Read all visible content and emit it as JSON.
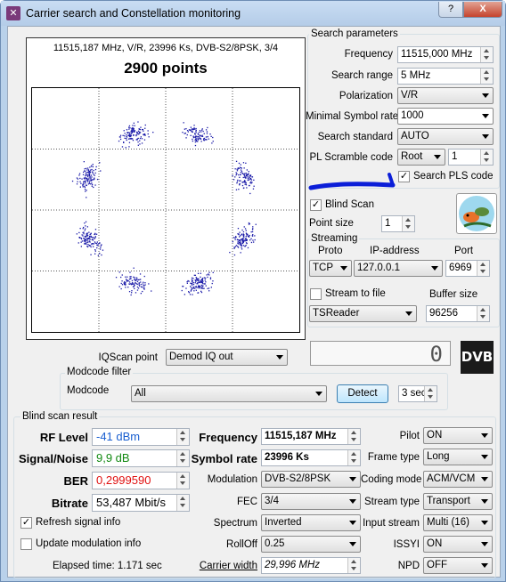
{
  "window": {
    "title": "Carrier search and Constellation monitoring",
    "help": "?",
    "close": "X"
  },
  "plot": {
    "info": "11515,187 MHz, V/R, 23996 Ks, DVB-S2/8PSK, 3/4",
    "points_label": "2900 points"
  },
  "search": {
    "group": "Search parameters",
    "frequency_label": "Frequency",
    "frequency": "11515,000 MHz",
    "range_label": "Search range",
    "range": "5 MHz",
    "polarization_label": "Polarization",
    "polarization": "V/R",
    "minsr_label": "Minimal Symbol rate",
    "minsr": "1000",
    "standard_label": "Search standard",
    "standard": "AUTO",
    "plscramble_label": "PL Scramble code",
    "plscramble_mode": "Root",
    "plscramble_value": "1",
    "search_pls_label": "Search PLS code"
  },
  "blind": {
    "label": "Blind Scan",
    "pointsize_label": "Point size",
    "pointsize": "1"
  },
  "streaming": {
    "group": "Streaming",
    "proto_label": "Proto",
    "ip_label": "IP-address",
    "port_label": "Port",
    "proto": "TCP",
    "ip": "127.0.0.1",
    "port": "6969",
    "stream_to_file": "Stream to file",
    "buffer_label": "Buffer size",
    "reader": "TSReader",
    "buffer": "96256"
  },
  "iq": {
    "label": "IQScan point",
    "value": "Demod IQ out",
    "lcd": "0"
  },
  "modcode": {
    "group": "Modcode filter",
    "label": "Modcode",
    "value": "All",
    "detect": "Detect",
    "interval": "3 sec"
  },
  "result": {
    "group": "Blind scan result",
    "rflevel_label": "RF Level",
    "rflevel": "-41 dBm",
    "sn_label": "Signal/Noise",
    "sn": "9,9 dB",
    "ber_label": "BER",
    "ber": "0,2999590",
    "bitrate_label": "Bitrate",
    "bitrate": "53,487 Mbit/s",
    "refresh_label": "Refresh signal info",
    "update_label": "Update modulation info",
    "elapsed": "Elapsed time: 1.171 sec",
    "freq_label": "Frequency",
    "freq": "11515,187 MHz",
    "sr_label": "Symbol rate",
    "sr": "23996 Ks",
    "mod_label": "Modulation",
    "mod": "DVB-S2/8PSK",
    "fec_label": "FEC",
    "fec": "3/4",
    "spectrum_label": "Spectrum",
    "spectrum": "Inverted",
    "rolloff_label": "RollOff",
    "rolloff": "0.25",
    "cw_label": "Carrier width",
    "cw": "29,996 MHz",
    "pilot_label": "Pilot",
    "pilot": "ON",
    "frame_label": "Frame type",
    "frame": "Long",
    "coding_label": "Coding mode",
    "coding": "ACM/VCM",
    "stype_label": "Stream type",
    "stype": "Transport",
    "istream_label": "Input stream",
    "istream": "Multi (16)",
    "issyi_label": "ISSYI",
    "issyi": "ON",
    "npd_label": "NPD",
    "npd": "OFF"
  },
  "colors": {
    "rflevel": "#1a5fd0",
    "sn": "#138a13",
    "ber": "#e01010",
    "dots": "#1a1aa8"
  },
  "icons": [
    "app-icon",
    "help-icon",
    "close-icon",
    "dvb-logo",
    "fish-logo",
    "dropdown-arrow",
    "spin-arrows"
  ]
}
